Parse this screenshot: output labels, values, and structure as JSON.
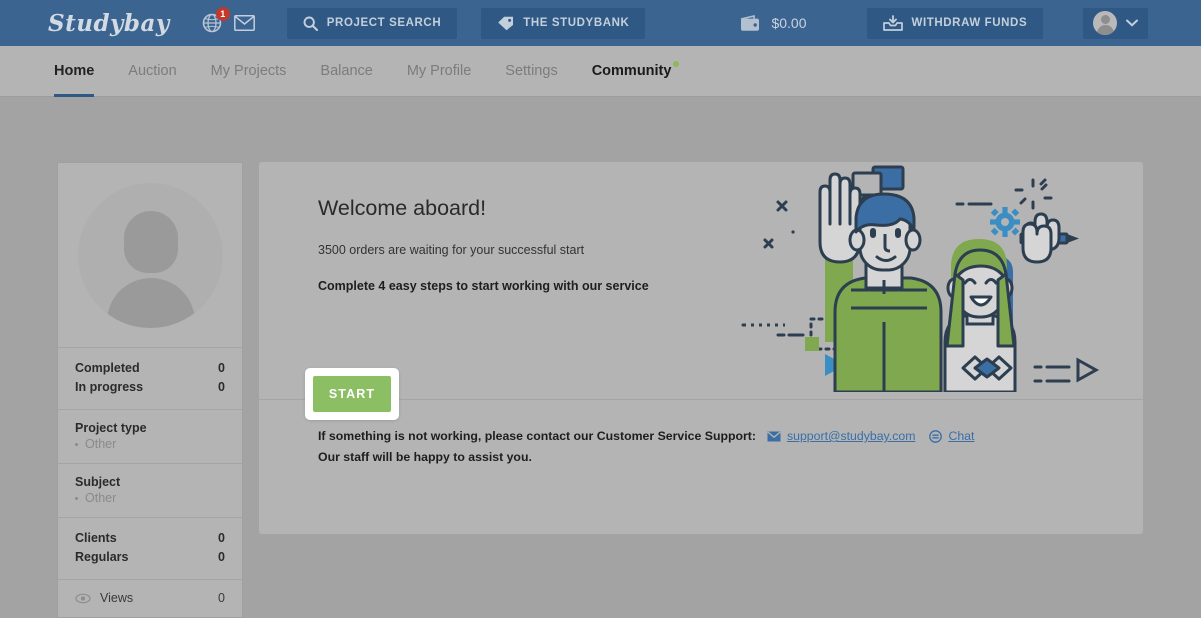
{
  "header": {
    "logo": "Studybay",
    "notifications_badge": "1",
    "project_search_label": "PROJECT SEARCH",
    "studybank_label": "THE STUDYBANK",
    "balance": "$0.00",
    "withdraw_label": "WITHDRAW FUNDS",
    "icons": {
      "globe": "globe-icon",
      "mail": "envelope-icon",
      "search": "search-icon",
      "tag": "tag-icon",
      "wallet": "wallet-icon",
      "withdraw": "withdraw-icon",
      "chevron": "chevron-down-icon"
    },
    "colors": {
      "bar": "#3c6490",
      "button": "#2f5984",
      "badge": "#c0392b"
    }
  },
  "nav": {
    "items": [
      {
        "label": "Home",
        "active": true
      },
      {
        "label": "Auction",
        "active": false
      },
      {
        "label": "My Projects",
        "active": false
      },
      {
        "label": "Balance",
        "active": false
      },
      {
        "label": "My Profile",
        "active": false
      },
      {
        "label": "Settings",
        "active": false
      },
      {
        "label": "Community",
        "active": false,
        "strong": true,
        "dot": true
      }
    ],
    "active_color": "#2f5984",
    "dot_color": "#8ab85b"
  },
  "sidebar": {
    "avatar": "user-avatar-placeholder",
    "stats": [
      {
        "label": "Completed",
        "value": "0"
      },
      {
        "label": "In progress",
        "value": "0"
      }
    ],
    "project_type": {
      "title": "Project type",
      "items": [
        "Other"
      ]
    },
    "subject": {
      "title": "Subject",
      "items": [
        "Other"
      ]
    },
    "clients": [
      {
        "label": "Clients",
        "value": "0"
      },
      {
        "label": "Regulars",
        "value": "0"
      }
    ],
    "views": {
      "label": "Views",
      "value": "0",
      "icon": "eye-icon"
    }
  },
  "main": {
    "title": "Welcome aboard!",
    "subtitle": "3500 orders are waiting for your successful start",
    "steps_text": "Complete 4 easy steps to start working with our service",
    "start_label": "START",
    "start_color": "#8cbf63",
    "support": {
      "line1": "If something is not working, please contact our Customer Service Support:",
      "line2": "Our staff will be happy to assist you.",
      "email": "support@studybay.com",
      "chat": "Chat",
      "link_color": "#3a6ea5"
    },
    "illustration": {
      "name": "two-people-waving-illustration",
      "colors": {
        "green": "#7fa84f",
        "blue": "#3a6ea5",
        "outline": "#2c3e50",
        "skin": "#d5d5d5"
      }
    }
  }
}
